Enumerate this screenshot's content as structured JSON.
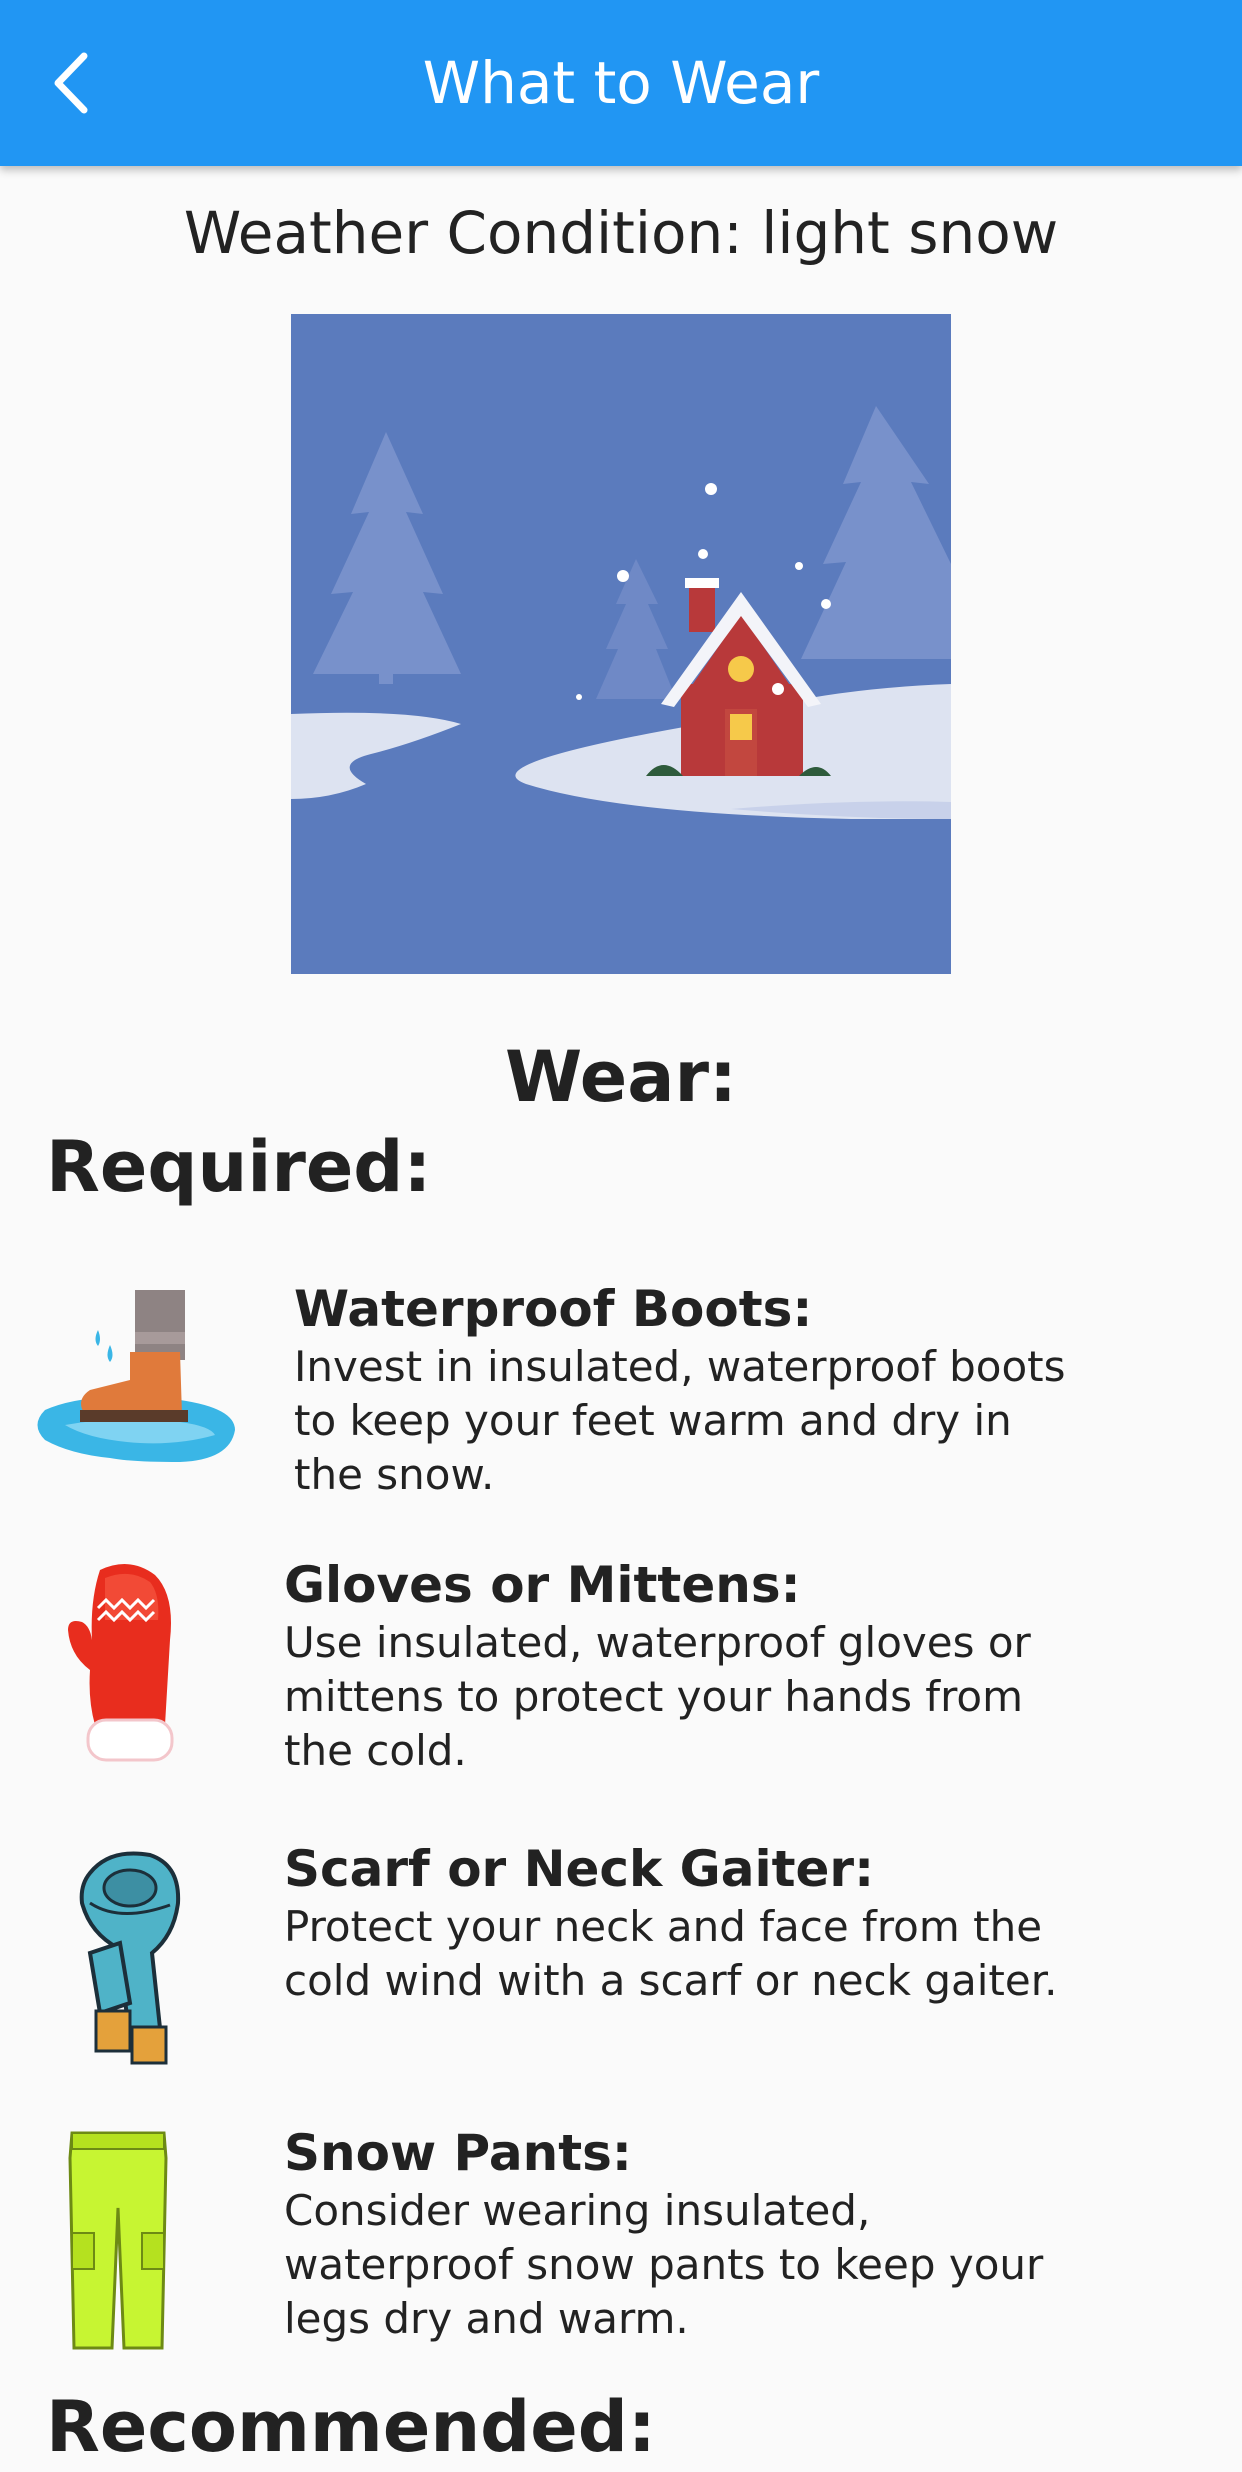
{
  "appbar": {
    "title": "What to Wear",
    "back_icon": "chevron-left-icon",
    "color": "#2196f3"
  },
  "condition": {
    "text": "Weather Condition: light snow"
  },
  "hero": {
    "icon": "snowy-house-illustration",
    "background": "#5b7bbd"
  },
  "wear_heading": "Wear:",
  "required": {
    "heading": "Required:",
    "items": [
      {
        "icon": "boot-icon",
        "title": "Waterproof Boots:",
        "description": "Invest in insulated, waterproof boots to keep your feet warm and dry in the snow."
      },
      {
        "icon": "mitten-icon",
        "title": "Gloves or Mittens:",
        "description": "Use insulated, waterproof gloves or mittens to protect your hands from the cold."
      },
      {
        "icon": "scarf-icon",
        "title": "Scarf or Neck Gaiter:",
        "description": "Protect your neck and face from the cold wind with a scarf or neck gaiter."
      },
      {
        "icon": "snow-pants-icon",
        "title": "Snow Pants:",
        "description": "Consider wearing insulated, waterproof snow pants to keep your legs dry and warm."
      }
    ]
  },
  "recommended": {
    "heading": "Recommended:"
  }
}
